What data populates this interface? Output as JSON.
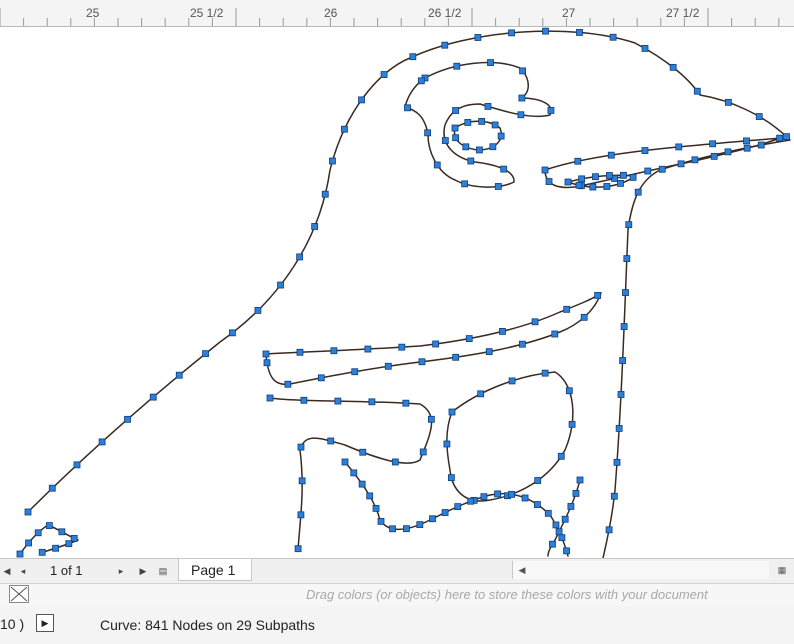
{
  "ruler": {
    "labels": [
      "25",
      "25  1/2",
      "26",
      "26  1/2",
      "27",
      "27  1/2"
    ]
  },
  "page_nav": {
    "first_icon": "first-page-icon",
    "prev_icon": "previous-page-icon",
    "count": "1 of 1",
    "next_icon": "next-page-icon",
    "last_icon": "last-page-icon",
    "add_page_icon": "add-page-icon",
    "tab_label": "Page 1"
  },
  "palette": {
    "no_color_icon": "no-color-swatch-icon",
    "hint": "Drag colors (or objects) here to store these colors with your document"
  },
  "status": {
    "left_fragment": "10 )",
    "arrow_icon": "play-arrow-icon",
    "text": "Curve: 841 Nodes on 29 Subpaths"
  },
  "colors": {
    "curve_stroke": "#3a2a20",
    "node_fill": "#2f7fd8",
    "node_border": "#0b3f7a"
  }
}
